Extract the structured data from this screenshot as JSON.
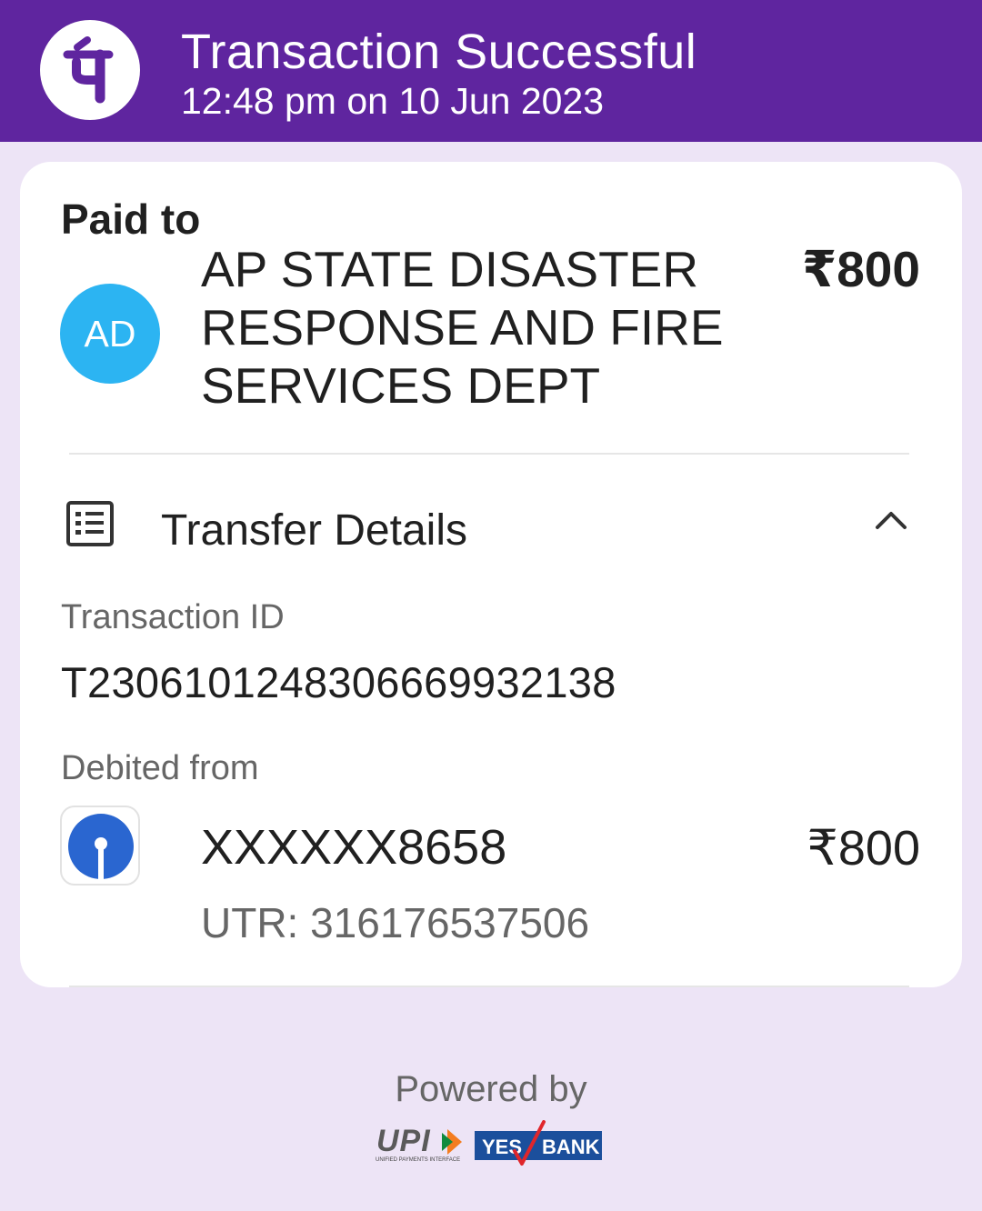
{
  "header": {
    "title": "Transaction Successful",
    "subtitle": "12:48 pm on 10 Jun 2023",
    "logo_icon": "phonepe-logo-icon",
    "brand_color": "#5f259f"
  },
  "payment": {
    "section_label": "Paid to",
    "avatar_initials": "AD",
    "avatar_color": "#2cb4f2",
    "payee_name": "AP STATE DISASTER RESPONSE AND FIRE SERVICES DEPT",
    "amount": "₹800"
  },
  "transfer": {
    "title": "Transfer Details",
    "icon": "receipt-list-icon",
    "toggle_icon": "chevron-up-icon",
    "transaction_id_label": "Transaction ID",
    "transaction_id": "T2306101248306669932138",
    "debited_label": "Debited from",
    "bank_icon": "sbi-bank-logo-icon",
    "account": "XXXXXX8658",
    "debited_amount": "₹800",
    "utr": "UTR: 316176537506"
  },
  "footer": {
    "powered_by": "Powered by",
    "upi_logo_text": "UPI",
    "upi_tagline": "UNIFIED PAYMENTS INTERFACE",
    "bank_logo_text_1": "YES",
    "bank_logo_text_2": "BANK"
  }
}
